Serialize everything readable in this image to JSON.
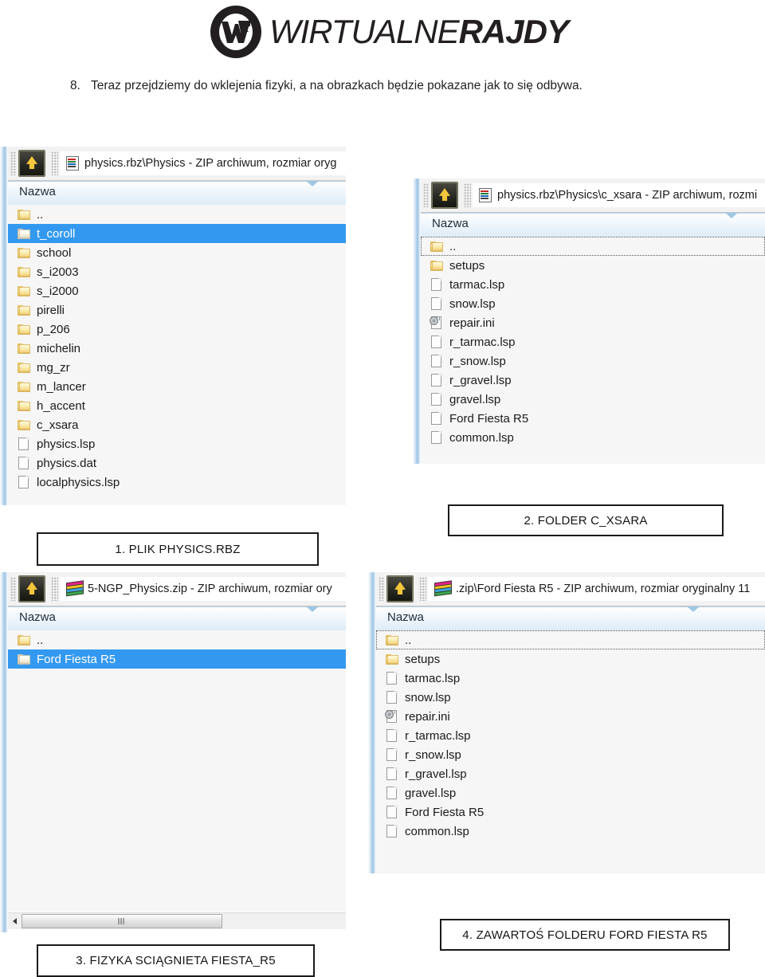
{
  "brand": {
    "name_light": "WIRTUALNE",
    "name_bold": "RAJDY",
    "logo_icon": "wr-circle-logo"
  },
  "intro": {
    "number": "8.",
    "text": "Teraz przejdziemy do wklejenia fizyki, a na obrazkach będzie pokazane jak to się odbywa."
  },
  "column_header": "Nazwa",
  "panels": [
    {
      "id": "panel-1",
      "toolbar": {
        "up_button_icon": "up-arrow-icon",
        "title_icon": "archive-doc-icon",
        "title": "physics.rbz\\Physics - ZIP archiwum, rozmiar oryg"
      },
      "rows": [
        {
          "name": "..",
          "icon": "folder-icon",
          "selected": false
        },
        {
          "name": "t_coroll",
          "icon": "folder-icon",
          "selected": true
        },
        {
          "name": "school",
          "icon": "folder-icon",
          "selected": false
        },
        {
          "name": "s_i2003",
          "icon": "folder-icon",
          "selected": false
        },
        {
          "name": "s_i2000",
          "icon": "folder-icon",
          "selected": false
        },
        {
          "name": "pirelli",
          "icon": "folder-icon",
          "selected": false
        },
        {
          "name": "p_206",
          "icon": "folder-icon",
          "selected": false
        },
        {
          "name": "michelin",
          "icon": "folder-icon",
          "selected": false
        },
        {
          "name": "mg_zr",
          "icon": "folder-icon",
          "selected": false
        },
        {
          "name": "m_lancer",
          "icon": "folder-icon",
          "selected": false
        },
        {
          "name": "h_accent",
          "icon": "folder-icon",
          "selected": false
        },
        {
          "name": "c_xsara",
          "icon": "folder-icon",
          "selected": false
        },
        {
          "name": "physics.lsp",
          "icon": "file-icon",
          "selected": false
        },
        {
          "name": "physics.dat",
          "icon": "file-icon",
          "selected": false
        },
        {
          "name": "localphysics.lsp",
          "icon": "file-icon",
          "selected": false
        }
      ]
    },
    {
      "id": "panel-2",
      "toolbar": {
        "up_button_icon": "up-arrow-icon",
        "title_icon": "archive-doc-icon",
        "title": "physics.rbz\\Physics\\c_xsara - ZIP archiwum, rozmi"
      },
      "rows": [
        {
          "name": "..",
          "icon": "folder-icon",
          "focused": true
        },
        {
          "name": "setups",
          "icon": "folder-icon"
        },
        {
          "name": "tarmac.lsp",
          "icon": "file-icon"
        },
        {
          "name": "snow.lsp",
          "icon": "file-icon"
        },
        {
          "name": "repair.ini",
          "icon": "ini-icon"
        },
        {
          "name": "r_tarmac.lsp",
          "icon": "file-icon"
        },
        {
          "name": "r_snow.lsp",
          "icon": "file-icon"
        },
        {
          "name": "r_gravel.lsp",
          "icon": "file-icon"
        },
        {
          "name": "gravel.lsp",
          "icon": "file-icon"
        },
        {
          "name": "Ford Fiesta R5",
          "icon": "file-icon"
        },
        {
          "name": "common.lsp",
          "icon": "file-icon"
        }
      ]
    },
    {
      "id": "panel-3",
      "toolbar": {
        "up_button_icon": "up-arrow-icon",
        "title_icon": "zip-stack-icon",
        "title": "5-NGP_Physics.zip - ZIP archiwum, rozmiar ory"
      },
      "rows": [
        {
          "name": "..",
          "icon": "folder-icon",
          "selected": false
        },
        {
          "name": "Ford Fiesta R5",
          "icon": "folder-icon",
          "selected": true
        }
      ],
      "scrollbar": {
        "left_arrow_icon": "scroll-left-arrow-icon",
        "thumb_grip_icon": "grip-icon"
      }
    },
    {
      "id": "panel-4",
      "toolbar": {
        "up_button_icon": "up-arrow-icon",
        "title_icon": "zip-stack-icon",
        "title": ".zip\\Ford Fiesta R5 - ZIP archiwum, rozmiar oryginalny 11"
      },
      "rows": [
        {
          "name": "..",
          "icon": "folder-icon",
          "focused": true
        },
        {
          "name": "setups",
          "icon": "folder-icon"
        },
        {
          "name": "tarmac.lsp",
          "icon": "file-icon"
        },
        {
          "name": "snow.lsp",
          "icon": "file-icon"
        },
        {
          "name": "repair.ini",
          "icon": "ini-icon"
        },
        {
          "name": "r_tarmac.lsp",
          "icon": "file-icon"
        },
        {
          "name": "r_snow.lsp",
          "icon": "file-icon"
        },
        {
          "name": "r_gravel.lsp",
          "icon": "file-icon"
        },
        {
          "name": "gravel.lsp",
          "icon": "file-icon"
        },
        {
          "name": "Ford Fiesta R5",
          "icon": "file-icon"
        },
        {
          "name": "common.lsp",
          "icon": "file-icon"
        }
      ]
    }
  ],
  "captions": [
    {
      "id": "caption-1",
      "text": "1.    PLIK PHYSICS.RBZ"
    },
    {
      "id": "caption-2",
      "text": "2. FOLDER C_XSARA"
    },
    {
      "id": "caption-3",
      "text": "3. FIZYKA SCIĄGNIETA FIESTA_R5"
    },
    {
      "id": "caption-4",
      "text": "4. ZAWARTOŚ FOLDERU FORD FIESTA R5"
    }
  ],
  "colors": {
    "selection_blue": "#3399f0",
    "header_blue": "#dcebf7",
    "list_bg": "#f6f6f6",
    "text": "#1a1a1a"
  }
}
